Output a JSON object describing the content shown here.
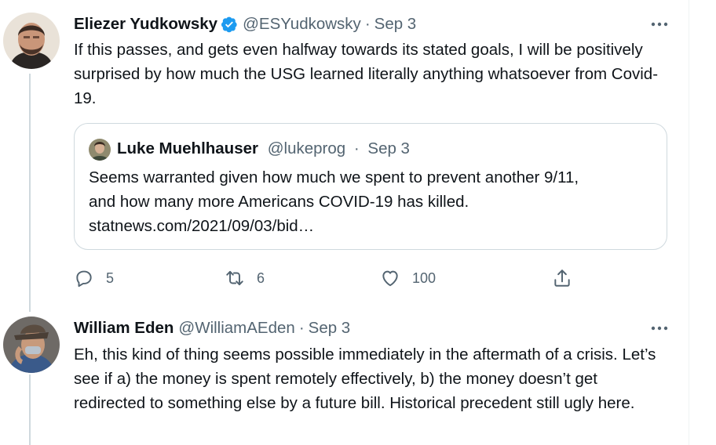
{
  "tweet": {
    "author_name": "Eliezer Yudkowsky",
    "author_handle": "@ESYudkowsky",
    "separator": "·",
    "date": "Sep 3",
    "text": "If this passes, and gets even halfway towards its stated goals, I will be positively surprised by how much the USG learned literally anything whatsoever from Covid-19.",
    "quoted": {
      "author_name": "Luke Muehlhauser",
      "author_handle": "@lukeprog",
      "date": "Sep 3",
      "text_line1": "Seems warranted given how much we spent to prevent another 9/11,",
      "text_line2": "and how many more Americans COVID-19 has killed.",
      "link": "statnews.com/2021/09/03/bid…"
    },
    "counts": {
      "replies": "5",
      "retweets": "6",
      "likes": "100"
    }
  },
  "reply": {
    "author_name": "William Eden",
    "author_handle": "@WilliamAEden",
    "separator": "·",
    "date": "Sep 3",
    "text": "Eh, this kind of thing seems possible immediately in the aftermath of a crisis. Let’s see if a) the money is spent remotely effectively, b) the money doesn’t get redirected to something else by a future bill. Historical precedent still ugly here."
  },
  "colors": {
    "verified": "#1d9bf0",
    "muted": "#536471",
    "border": "#cfd9de"
  }
}
